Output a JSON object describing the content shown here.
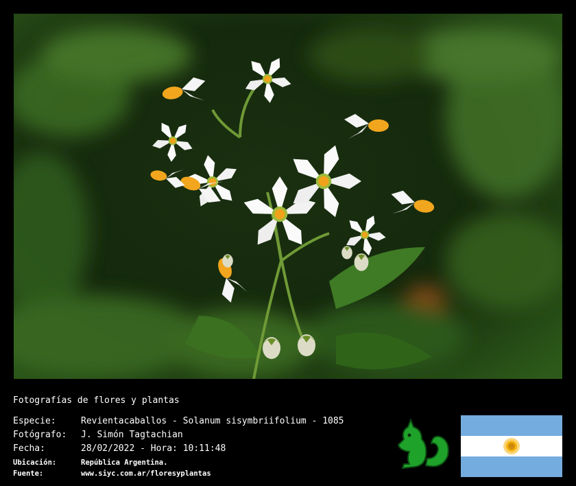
{
  "caption": "Fotografías de flores y plantas",
  "fields": {
    "species": {
      "label": "Especie:",
      "value": "Revientacaballos - Solanum sisymbriifolium - 1085"
    },
    "photographer": {
      "label": "Fotógrafo:",
      "value": "J. Simón Tagtachian"
    },
    "date": {
      "label": "Fecha:",
      "value": "28/02/2022 - Hora: 10:11:48"
    },
    "location": {
      "label": "Ubicación:",
      "value": "República Argentina."
    },
    "source": {
      "label": "Fuente:",
      "value": "www.siyc.com.ar/floresyplantas"
    }
  },
  "colors": {
    "background": "#000000",
    "text": "#ffffff",
    "logo_green": "#1fa22a",
    "flag_blue": "#74acdf",
    "flag_sun": "#f6b40e"
  },
  "icons": {
    "logo": "green-squirrel-icon",
    "flag": "argentina-flag-icon"
  }
}
